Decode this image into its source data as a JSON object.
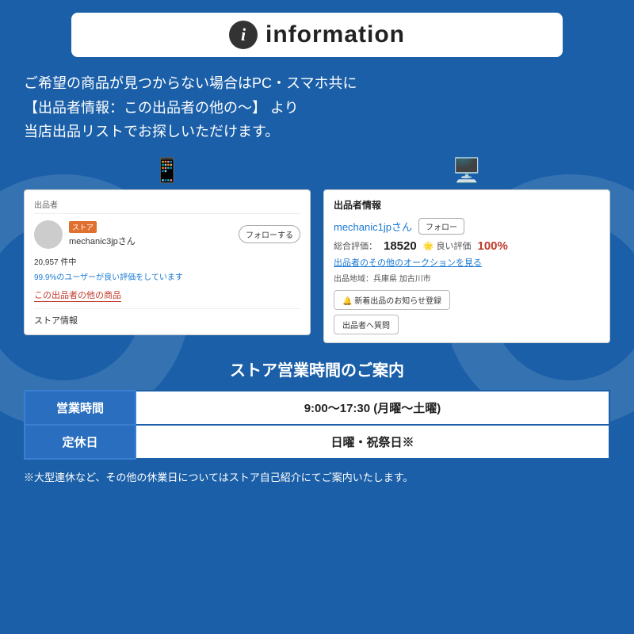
{
  "header": {
    "title": "information",
    "icon_label": "i"
  },
  "main_text": {
    "line1": "ご希望の商品が見つからない場合はPC・スマホ共に",
    "line2": "【出品者情報：この出品者の他の〜】 より",
    "line3": "当店出品リストでお探しいただけます。"
  },
  "left_panel": {
    "label": "出品者",
    "store_badge": "ストア",
    "seller_name": "mechanic3jpさん",
    "follow_label": "フォローする",
    "stats": "20,957 件中",
    "positive_rate": "99.9%のユーザーが良い評価をしています",
    "link_text": "この出品者の他の商品",
    "store_info": "ストア情報"
  },
  "right_panel": {
    "label": "出品者情報",
    "seller_name": "mechanic1jpさん",
    "follow_label": "フォロー",
    "rating_label": "総合評価：",
    "rating_num": "18520",
    "good_label": "🌟 良い評価",
    "good_pct": "100%",
    "auction_link": "出品者のその他のオークションを見る",
    "location_label": "出品地域：兵庫県 加古川市",
    "notify_btn": "🔔 新着出品のお知らせ登録",
    "question_btn": "出品者へ質問"
  },
  "store_hours": {
    "title": "ストア営業時間のご案内",
    "rows": [
      {
        "label": "営業時間",
        "value": "9:00〜17:30 (月曜〜土曜)"
      },
      {
        "label": "定休日",
        "value": "日曜・祝祭日※"
      }
    ],
    "note": "※大型連休など、その他の休業日についてはストア自己紹介にてご案内いたします。"
  },
  "colors": {
    "background": "#1a5fa8",
    "accent_blue": "#1a7ad4",
    "accent_red": "#c0392b",
    "white": "#ffffff",
    "store_badge": "#e07030"
  }
}
